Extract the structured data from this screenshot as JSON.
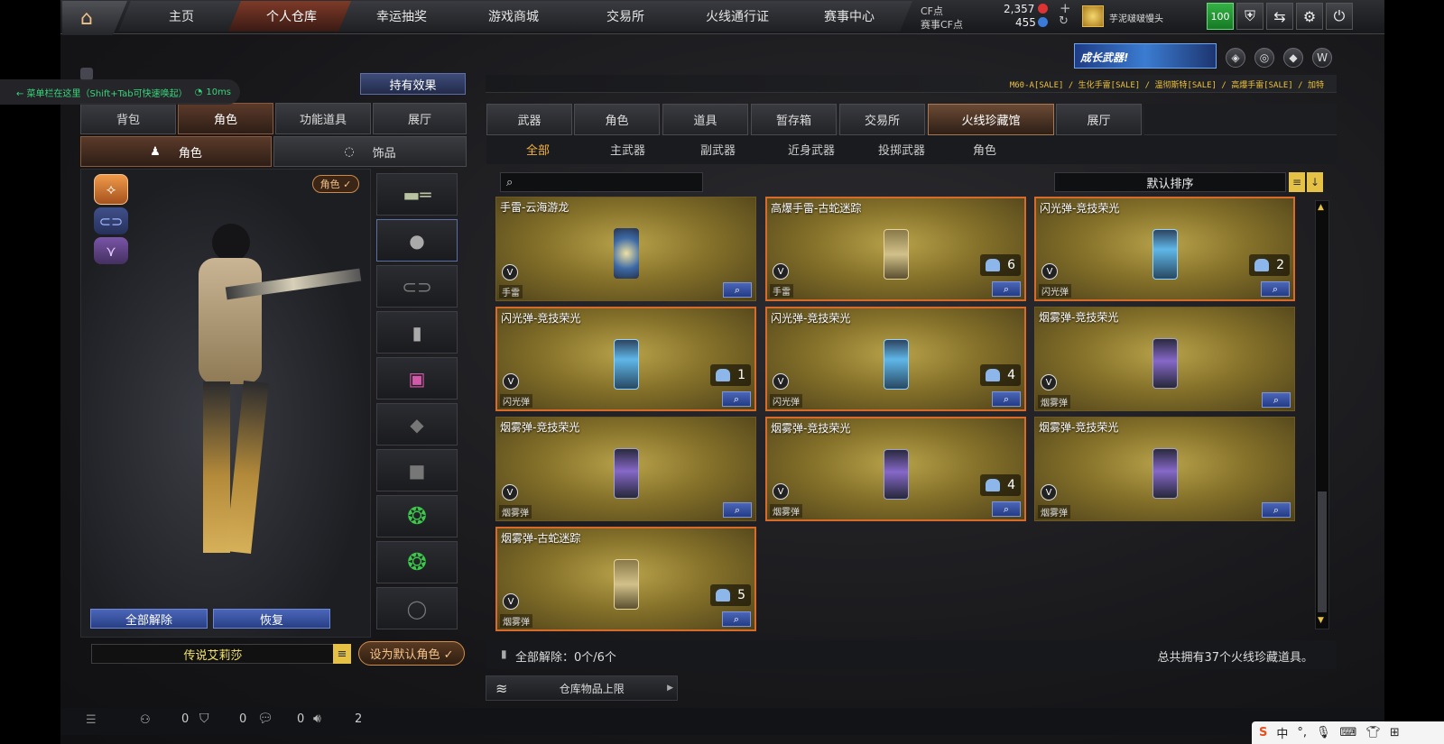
{
  "nav": {
    "items": [
      "主页",
      "个人仓库",
      "幸运抽奖",
      "游戏商城",
      "交易所",
      "火线通行证",
      "赛事中心"
    ],
    "active_index": 1
  },
  "currency": {
    "cf_label": "CF点",
    "cf_value": "2,357",
    "event_cf_label": "赛事CF点",
    "event_cf_value": "455"
  },
  "user": {
    "name": "芋泥啵啵慢头",
    "level": "100"
  },
  "banner": {
    "text": "成长武器!"
  },
  "sale_text": "M60-A[SALE] / 生化手雷[SALE] / 温彻斯特[SALE] / 高爆手雷[SALE] / 加特",
  "overlay": {
    "text": "← 菜单栏在这里（Shift+Tab可快速唤起）",
    "ping": "10ms"
  },
  "left": {
    "holding_effect": "持有效果",
    "tabs": [
      "背包",
      "角色",
      "功能道具",
      "展厅"
    ],
    "active_tab": 1,
    "subtabs": [
      "角色",
      "饰品"
    ],
    "role_badge": "角色 ✓",
    "release_all": "全部解除",
    "restore": "恢复",
    "character_name": "传说艾莉莎",
    "set_default": "设为默认角色 ✓"
  },
  "right": {
    "tabs": [
      "武器",
      "角色",
      "道具",
      "暂存箱",
      "交易所",
      "火线珍藏馆",
      "展厅"
    ],
    "active_tab": 5,
    "subtabs": [
      "全部",
      "主武器",
      "副武器",
      "近身武器",
      "投掷武器",
      "角色"
    ],
    "active_subtab": 0,
    "search_placeholder": "",
    "sort_label": "默认排序",
    "items": [
      {
        "name": "手雷-云海游龙",
        "category": "手雷",
        "count": "",
        "kind": "gr",
        "selected": false
      },
      {
        "name": "高爆手雷-古蛇迷踪",
        "category": "手雷",
        "count": "6",
        "kind": "gold",
        "selected": true
      },
      {
        "name": "闪光弹-竞技荣光",
        "category": "闪光弹",
        "count": "2",
        "kind": "fl",
        "selected": true
      },
      {
        "name": "闪光弹-竞技荣光",
        "category": "闪光弹",
        "count": "1",
        "kind": "fl",
        "selected": true
      },
      {
        "name": "闪光弹-竞技荣光",
        "category": "闪光弹",
        "count": "4",
        "kind": "fl",
        "selected": true
      },
      {
        "name": "烟雾弹-竞技荣光",
        "category": "烟雾弹",
        "count": "",
        "kind": "sm",
        "selected": false
      },
      {
        "name": "烟雾弹-竞技荣光",
        "category": "烟雾弹",
        "count": "",
        "kind": "sm",
        "selected": false
      },
      {
        "name": "烟雾弹-竞技荣光",
        "category": "烟雾弹",
        "count": "4",
        "kind": "sm",
        "selected": true
      },
      {
        "name": "烟雾弹-竞技荣光",
        "category": "烟雾弹",
        "count": "",
        "kind": "sm",
        "selected": false
      },
      {
        "name": "烟雾弹-古蛇迷踪",
        "category": "烟雾弹",
        "count": "5",
        "kind": "gold",
        "selected": true
      }
    ],
    "release_status": "全部解除：0个/6个",
    "total_text": "总共拥有37个火线珍藏道具。",
    "warehouse_limit": "仓库物品上限"
  },
  "bottom": {
    "values": [
      "0",
      "0",
      "0",
      "2"
    ]
  },
  "ime": {
    "lang": "中"
  }
}
